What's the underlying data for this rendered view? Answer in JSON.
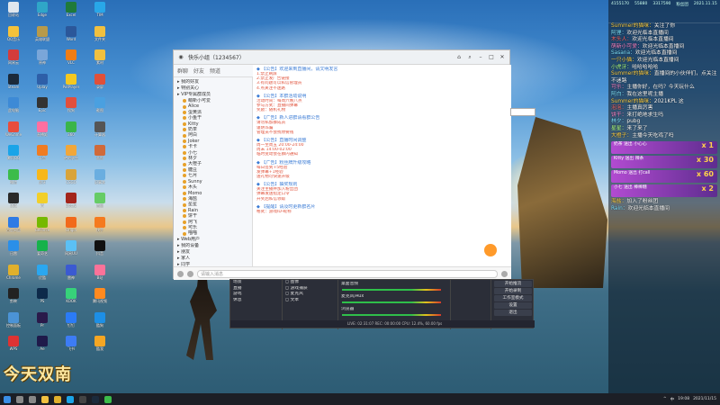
{
  "desktop": {
    "icons": [
      {
        "label": "回收站",
        "color": "#dfe6ee"
      },
      {
        "label": "QQ音乐",
        "color": "#f6c23a"
      },
      {
        "label": "网易云",
        "color": "#d43c3c"
      },
      {
        "label": "Steam",
        "color": "#1b2a3b"
      },
      {
        "label": "此电脑",
        "color": "#3d8ad6"
      },
      {
        "label": "WeGame",
        "color": "#e84d3c"
      },
      {
        "label": "腾讯QQ",
        "color": "#1aa4e8"
      },
      {
        "label": "微信",
        "color": "#3cbc4a"
      },
      {
        "label": "OBS",
        "color": "#2a2a2a"
      },
      {
        "label": "百度网盘",
        "color": "#2f7be4"
      },
      {
        "label": "迅雷",
        "color": "#2b8fe8"
      },
      {
        "label": "Chrome",
        "color": "#e0b02c"
      },
      {
        "label": "剪映",
        "color": "#222"
      },
      {
        "label": "控制面板",
        "color": "#4b93d6"
      },
      {
        "label": "WPS",
        "color": "#d33"
      },
      {
        "label": "Edge",
        "color": "#2fa6c8"
      },
      {
        "label": "英雄联盟",
        "color": "#b89a4a"
      },
      {
        "label": "原神",
        "color": "#7aa6d9"
      },
      {
        "label": "Uplay",
        "color": "#2e5fa8"
      },
      {
        "label": "Epic",
        "color": "#333"
      },
      {
        "label": "直播姬",
        "color": "#ff6fa0"
      },
      {
        "label": "斗鱼",
        "color": "#f07c22"
      },
      {
        "label": "虎牙",
        "color": "#f7b71a"
      },
      {
        "label": "YY",
        "color": "#f2cf2a"
      },
      {
        "label": "GeForce",
        "color": "#76b900"
      },
      {
        "label": "爱奇艺",
        "color": "#16b24b"
      },
      {
        "label": "优酷",
        "color": "#2aa7f0"
      },
      {
        "label": "PS",
        "color": "#0d2a4a"
      },
      {
        "label": "Pr",
        "color": "#2a1a4a"
      },
      {
        "label": "Ae",
        "color": "#1f1a4a"
      },
      {
        "label": "Excel",
        "color": "#1f7a3a"
      },
      {
        "label": "Word",
        "color": "#2b579a"
      },
      {
        "label": "VLC",
        "color": "#f07d15"
      },
      {
        "label": "PotPlayer",
        "color": "#f4c820"
      },
      {
        "label": "搜狗",
        "color": "#e34f3c"
      },
      {
        "label": "360",
        "color": "#3ab54a"
      },
      {
        "label": "绝地求生",
        "color": "#f1a73a"
      },
      {
        "label": "CSGO",
        "color": "#d9a43b"
      },
      {
        "label": "Dota2",
        "color": "#a3251c"
      },
      {
        "label": "Origin",
        "color": "#f26a1b"
      },
      {
        "label": "网易UU",
        "color": "#5bc0f5"
      },
      {
        "label": "雷神",
        "color": "#3b5ad1"
      },
      {
        "label": "KOOK",
        "color": "#37d27a"
      },
      {
        "label": "钉钉",
        "color": "#2b7bf6"
      },
      {
        "label": "飞书",
        "color": "#3d7cf5"
      },
      {
        "label": "TIM",
        "color": "#28a7e8"
      },
      {
        "label": "文件夹",
        "color": "#f0c040"
      },
      {
        "label": "素材",
        "color": "#f0c040"
      },
      {
        "label": "录屏",
        "color": "#e0503a"
      },
      {
        "label": "截图",
        "color": "#4aa0e0"
      },
      {
        "label": "计算器",
        "color": "#555"
      },
      {
        "label": "画图",
        "color": "#d06a3a"
      },
      {
        "label": "记事本",
        "color": "#6aaee0"
      },
      {
        "label": "音量",
        "color": "#6c6"
      },
      {
        "label": "快手",
        "color": "#f57a1e"
      },
      {
        "label": "抖音",
        "color": "#111"
      },
      {
        "label": "B站",
        "color": "#fb7299"
      },
      {
        "label": "腾讯视频",
        "color": "#ff8a1f"
      },
      {
        "label": "酷狗",
        "color": "#1d8fe6"
      },
      {
        "label": "酷我",
        "color": "#f5a623"
      }
    ],
    "watermark": "今天双南"
  },
  "qq": {
    "title": "快乐小组（1234567）",
    "tabs": [
      "群聊",
      "好友",
      "频道"
    ],
    "groups": [
      {
        "name": "我的好友",
        "members": []
      },
      {
        "name": "特别关心",
        "members": []
      },
      {
        "name": "VIP专属群成员",
        "members": [
          "萌新小可爱",
          "Alice",
          "蛋黄派",
          "小鱼干",
          "Kitty",
          "奶茶",
          "阿白",
          "Joker",
          "卡卡",
          "小七",
          "林夕",
          "大橙子",
          "糖豆",
          "七月",
          "Sunny",
          "木头",
          "Momo",
          "海盐",
          "星星",
          "Rain",
          "饼干",
          "阿飞",
          "可乐",
          "喵喵"
        ]
      },
      {
        "name": "Web用户",
        "members": []
      },
      {
        "name": "我的设备",
        "members": []
      },
      {
        "name": "朋友",
        "members": []
      },
      {
        "name": "家人",
        "members": []
      },
      {
        "name": "同学",
        "members": []
      },
      {
        "name": "陌生人",
        "members": []
      },
      {
        "name": "黑名单",
        "members": []
      }
    ],
    "messages": [
      {
        "head": "【公告】欢迎来到直播间，请文明发言",
        "lines": [
          "1.禁止刷屏",
          "2.禁止发广告链接",
          "3.有问题可以私信管理员",
          "4.点关注不迷路"
        ]
      },
      {
        "head": "【公告】本群活动说明",
        "lines": [
          "活动时间：每周六晚八点",
          "参与方式：直播间弹幕",
          "奖励：随机礼物"
        ]
      },
      {
        "head": "【广告】新人进群请看群公告",
        "lines": [
          "请勿私加群成员",
          "谨防诈骗",
          "管理员不会找你要钱"
        ]
      },
      {
        "head": "【公告】直播时间调整",
        "lines": [
          "周一至周五 20:00-24:00",
          "周末 14:00-02:00",
          "临时变动会在群内通知"
        ]
      },
      {
        "head": "【广告】粉丝牌升级攻略",
        "lines": [
          "每日签到+5经验",
          "发弹幕+1经验",
          "送礼物可快速升级"
        ]
      },
      {
        "head": "【公告】抽奖规则",
        "lines": [
          "关注主播并加入粉丝团",
          "弹幕发送指定口令",
          "开奖后私信领取"
        ]
      },
      {
        "head": "【提醒】请及时更新群名片",
        "lines": [
          "格式：游戏ID-昵称"
        ]
      }
    ],
    "input_placeholder": "请输入消息"
  },
  "obs": {
    "scenes": [
      "场景",
      "直播",
      "游戏",
      "休息"
    ],
    "sources": [
      "图像",
      "游戏捕获",
      "麦克风",
      "文本"
    ],
    "mixer": [
      "桌面音频",
      "麦克风/Aux",
      "浏览器"
    ],
    "controls": [
      "开始推流",
      "开始录制",
      "工作室模式",
      "设置",
      "退出"
    ],
    "status": "LIVE: 02:31:07  REC: 00:00:00  CPU: 12.4%, 60.00 fps"
  },
  "danmaku": {
    "header": [
      "4155170",
      "55880",
      "3317590",
      "粉丝团",
      "2021.11.15"
    ],
    "items": [
      {
        "user": "Summer的猫咪",
        "text": "关注了你",
        "color": "#ffd34a"
      },
      {
        "user": "阿狸",
        "text": "欢迎光临本直播间",
        "color": "#7fe3ff"
      },
      {
        "user": "木头人",
        "text": "欢迎光临本直播间",
        "color": "#ff6b6b"
      },
      {
        "user": "萌新小可爱",
        "text": "欢迎光临本直播间",
        "color": "#ff8ad0"
      },
      {
        "user": "Sasana",
        "text": "欢迎光临本直播间",
        "color": "#7fe3ff"
      },
      {
        "user": "一只小猫",
        "text": "欢迎光临本直播间",
        "color": "#ffd34a"
      },
      {
        "user": "小虎牙",
        "text": "哈哈哈哈哈",
        "color": "#b0ff8a"
      },
      {
        "user": "Summer的猫咪",
        "text": "直播间的小伙伴们，点关注不迷路",
        "color": "#ffd34a"
      },
      {
        "user": "可乐",
        "text": "主播你好，在吗？今天玩什么",
        "color": "#ff8ad0"
      },
      {
        "user": "阿白",
        "text": "我在这里呢主播",
        "color": "#7fe3ff"
      },
      {
        "user": "Summer的猫咪",
        "text": "2021KPL 这",
        "color": "#ffd34a"
      },
      {
        "user": "泡泡",
        "text": "主播真厉害",
        "color": "#ff6b6b"
      },
      {
        "user": "饼干",
        "text": "来打绝地求生吗",
        "color": "#ff8ad0"
      },
      {
        "user": "林夕",
        "text": "pubg",
        "color": "#7fe3ff"
      },
      {
        "user": "星星",
        "text": "来了来了",
        "color": "#b0ff8a"
      },
      {
        "user": "大橙子",
        "text": "主播今天吃鸡了吗",
        "color": "#ffd34a"
      }
    ],
    "gifts": [
      {
        "user": "奶茶",
        "gift": "送出 小心心",
        "count": "x 1"
      },
      {
        "user": "Kitty",
        "gift": "送出 辣条",
        "count": "x 30"
      },
      {
        "user": "Momo",
        "gift": "送出 打call",
        "count": "x 60"
      },
      {
        "user": "小七",
        "gift": "送出 棒棒糖",
        "count": "x 2"
      }
    ],
    "footer": [
      {
        "user": "海盐",
        "text": "加入了粉丝团",
        "color": "#ffd34a"
      },
      {
        "user": "Rain",
        "text": "欢迎光临本直播间",
        "color": "#7fe3ff"
      }
    ]
  },
  "taskbar": {
    "apps": [
      "开始",
      "搜索",
      "任务视图",
      "文件资源管理器",
      "Chrome",
      "QQ",
      "OBS",
      "Steam",
      "微信"
    ],
    "tray": [
      "^",
      "中",
      "19:08",
      "2021/11/15"
    ]
  }
}
